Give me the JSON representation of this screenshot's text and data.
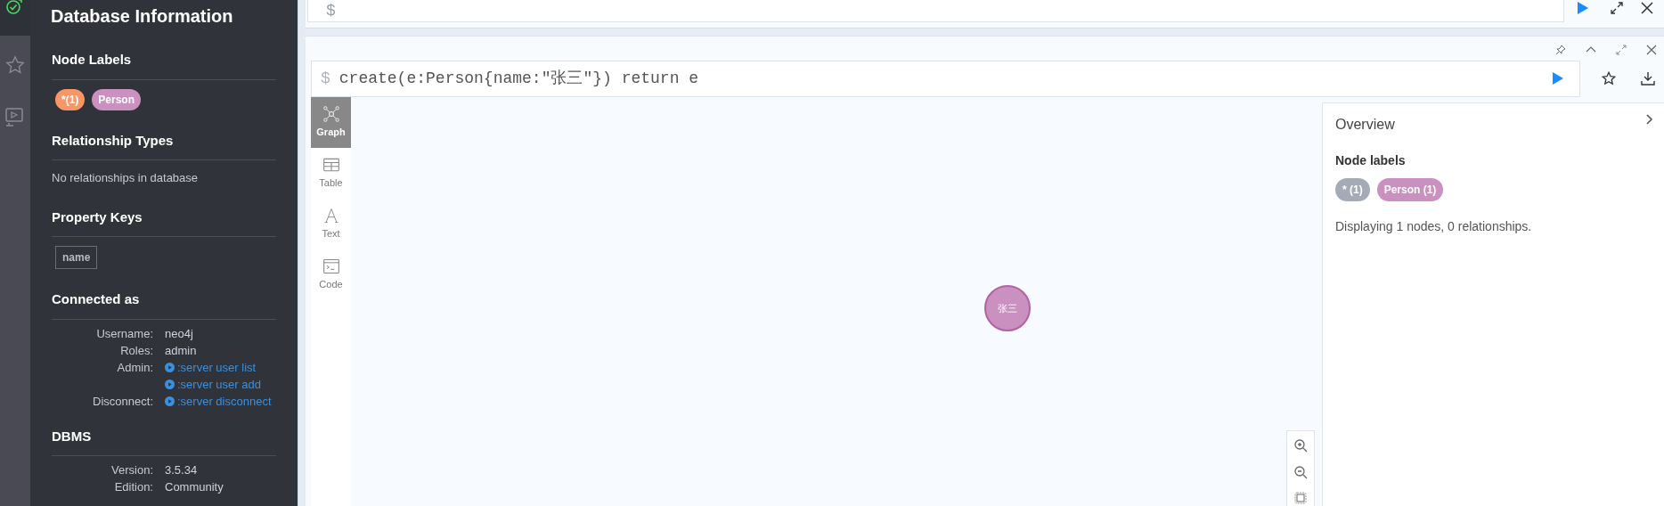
{
  "sidebar": {
    "title": "Database Information",
    "sections": [
      {
        "kind": "labels",
        "heading": "Node Labels",
        "labels": [
          {
            "text": "*(1)",
            "color": "#f79767"
          },
          {
            "text": "Person",
            "color": "#c990c0"
          }
        ]
      },
      {
        "kind": "text",
        "heading": "Relationship Types",
        "text": "No relationships in database"
      },
      {
        "kind": "keys",
        "heading": "Property Keys",
        "keys": [
          "name"
        ]
      },
      {
        "kind": "rows",
        "heading": "Connected as",
        "rows": [
          {
            "label": "Username:",
            "value": "neo4j",
            "kind": "text"
          },
          {
            "label": "Roles:",
            "value": "admin",
            "kind": "text"
          },
          {
            "label": "Admin:",
            "value": ":server user list",
            "kind": "link"
          },
          {
            "value": ":server user add",
            "kind": "link"
          },
          {
            "label": "Disconnect:",
            "value": ":server disconnect",
            "kind": "link"
          }
        ]
      },
      {
        "kind": "rows",
        "heading": "DBMS",
        "rows": [
          {
            "label": "Version:",
            "value": "3.5.34",
            "kind": "text"
          },
          {
            "label": "Edition:",
            "value": "Community",
            "kind": "text"
          }
        ]
      }
    ]
  },
  "editor": {
    "prompt": "$"
  },
  "frame": {
    "prompt": "$",
    "query": "create(e:Person{name:\"张三\"}) return e",
    "result_tabs": [
      {
        "label": "Graph",
        "kind": "graph",
        "selected": true
      },
      {
        "label": "Table",
        "kind": "table",
        "selected": false
      },
      {
        "label": "Text",
        "kind": "text",
        "selected": false
      },
      {
        "label": "Code",
        "kind": "code",
        "selected": false
      }
    ],
    "graph": {
      "nodes": [
        {
          "caption": "张三",
          "color": "#c990c0"
        }
      ]
    },
    "overview": {
      "title": "Overview",
      "heading": "Node labels",
      "labels": [
        {
          "text": "* (1)",
          "color": "#a5abb6"
        },
        {
          "text": "Person (1)",
          "color": "#c990c0"
        }
      ],
      "summary": "Displaying 1 nodes, 0 relationships."
    }
  }
}
